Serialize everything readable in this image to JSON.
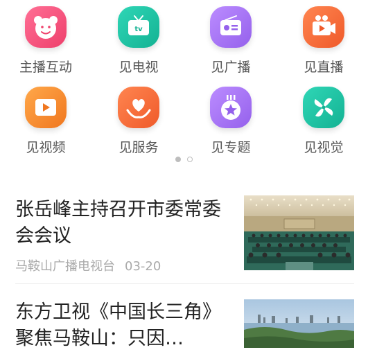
{
  "grid": [
    {
      "label": "主播互动",
      "icon": "bear-icon",
      "color": "#f2557d"
    },
    {
      "label": "见电视",
      "icon": "tv-icon",
      "color": "#1ec3a4"
    },
    {
      "label": "见广播",
      "icon": "radio-icon",
      "color": "#a775f0"
    },
    {
      "label": "见直播",
      "icon": "video-camera-icon",
      "color": "#f4693b"
    },
    {
      "label": "见视频",
      "icon": "play-icon",
      "color": "#f48a2d"
    },
    {
      "label": "见服务",
      "icon": "heart-hands-icon",
      "color": "#f4693b"
    },
    {
      "label": "见专题",
      "icon": "star-badge-icon",
      "color": "#a775f0"
    },
    {
      "label": "见视觉",
      "icon": "pinwheel-icon",
      "color": "#1ec3a4"
    }
  ],
  "pager": {
    "pages": 2,
    "current": 1
  },
  "news": [
    {
      "title": "张岳峰主持召开市委常委会会议",
      "source": "马鞍山广播电视台",
      "time": "03-20"
    },
    {
      "title": "东方卫视《中国长三角》聚焦马鞍山：只因…"
    }
  ]
}
